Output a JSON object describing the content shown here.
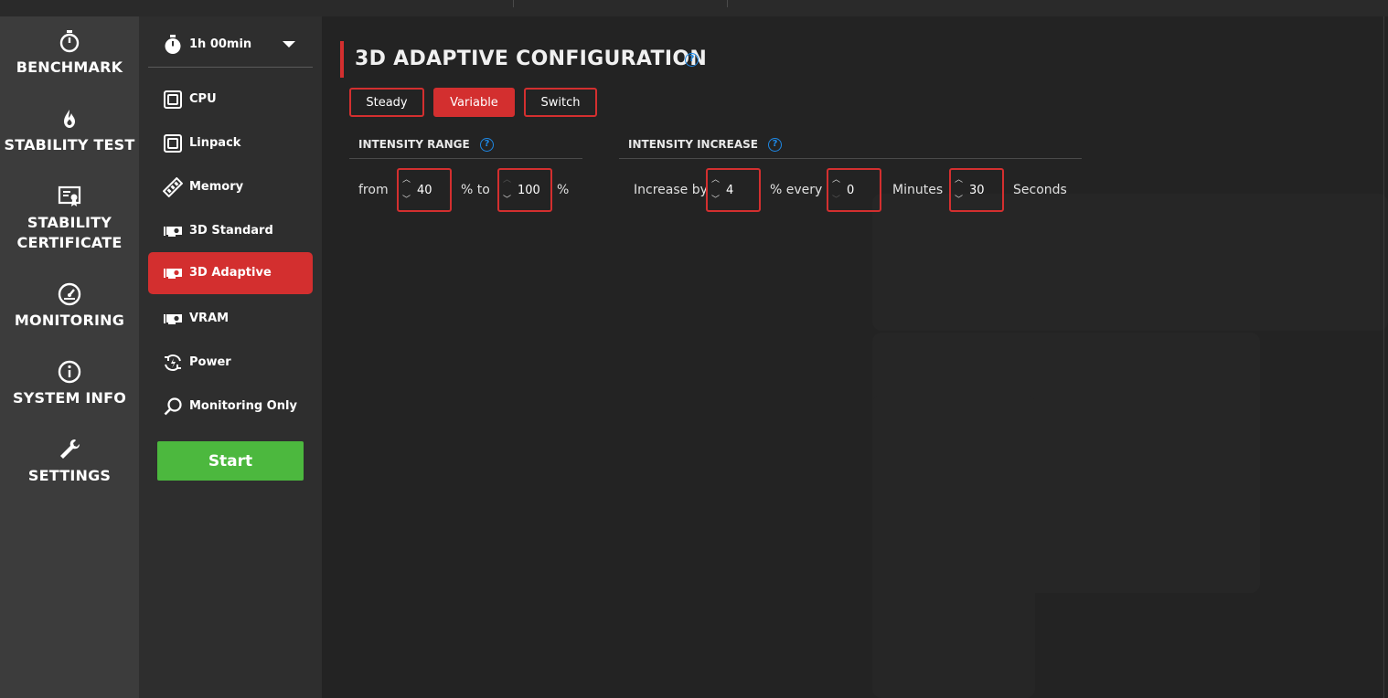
{
  "nav": {
    "items": [
      {
        "label": "BENCHMARK",
        "icon": "stopwatch-icon"
      },
      {
        "label": "STABILITY TEST",
        "icon": "flame-icon"
      },
      {
        "label": "STABILITY\nCERTIFICATE",
        "line1": "STABILITY",
        "line2": "CERTIFICATE",
        "icon": "certificate-icon"
      },
      {
        "label": "MONITORING",
        "icon": "gauge-icon"
      },
      {
        "label": "SYSTEM INFO",
        "icon": "info-icon"
      },
      {
        "label": "SETTINGS",
        "icon": "wrench-icon"
      }
    ]
  },
  "subnav": {
    "duration": "1h 00min",
    "items": [
      {
        "label": "CPU",
        "icon": "cpu-icon"
      },
      {
        "label": "Linpack",
        "icon": "cpu-icon"
      },
      {
        "label": "Memory",
        "icon": "memory-icon"
      },
      {
        "label": "3D Standard",
        "icon": "gpu-icon"
      },
      {
        "label": "3D Adaptive",
        "icon": "gpu-icon",
        "active": true
      },
      {
        "label": "VRAM",
        "icon": "gpu-icon"
      },
      {
        "label": "Power",
        "icon": "power-cycle-icon"
      },
      {
        "label": "Monitoring Only",
        "icon": "magnifier-icon"
      }
    ],
    "start_label": "Start"
  },
  "config": {
    "title": "3D ADAPTIVE CONFIGURATION",
    "modes": [
      {
        "label": "Steady",
        "active": false
      },
      {
        "label": "Variable",
        "active": true
      },
      {
        "label": "Switch",
        "active": false
      }
    ],
    "intensity_range": {
      "heading": "INTENSITY RANGE",
      "from_label": "from",
      "from_value": "40",
      "mid_label": "% to",
      "to_value": "100",
      "end_label": "%"
    },
    "intensity_increase": {
      "heading": "INTENSITY INCREASE",
      "increase_label": "Increase by",
      "increase_value": "4",
      "every_label": "% every",
      "minutes_value": "0",
      "minutes_label": "Minutes",
      "seconds_value": "30",
      "seconds_label": "Seconds"
    },
    "help_glyph": "?"
  },
  "colors": {
    "accent": "#d32f2f",
    "start": "#4cb83e",
    "help": "#1e88e5",
    "nav_bg": "#3c3c3c",
    "subnav_bg": "#2e2e2e",
    "main_bg": "#232323"
  }
}
